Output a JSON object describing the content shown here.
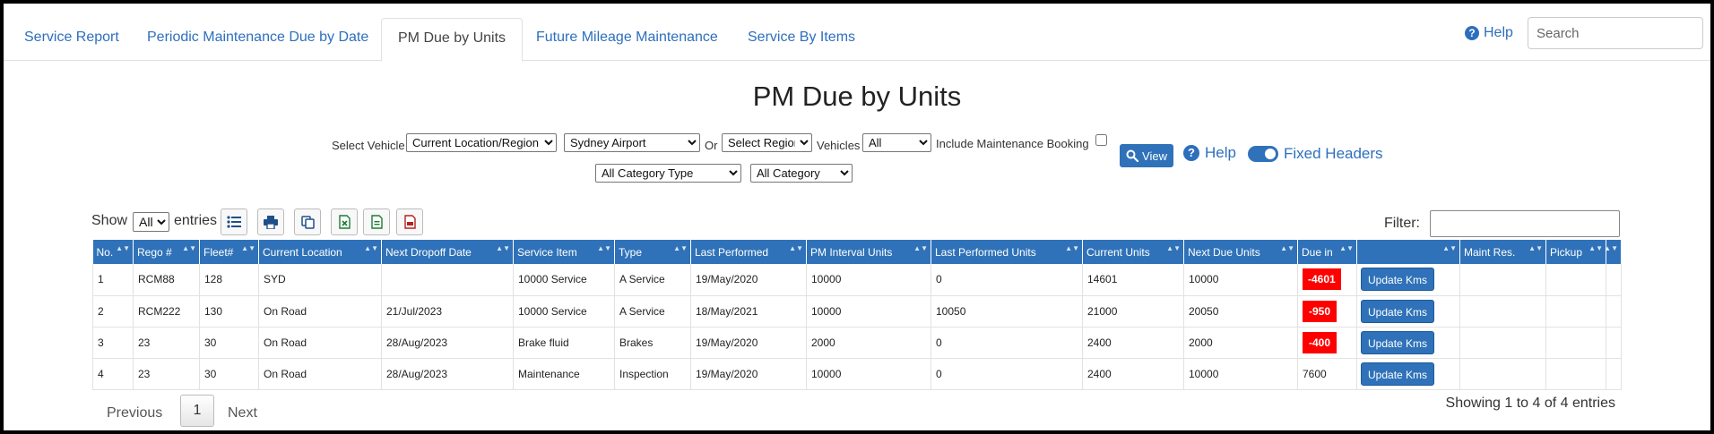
{
  "tabs": [
    {
      "label": "Service Report",
      "active": false
    },
    {
      "label": "Periodic Maintenance Due by Date",
      "active": false
    },
    {
      "label": "PM Due by Units",
      "active": true
    },
    {
      "label": "Future Mileage Maintenance",
      "active": false
    },
    {
      "label": "Service By Items",
      "active": false
    }
  ],
  "header": {
    "help_label": "Help",
    "search_placeholder": "Search"
  },
  "title": "PM Due by Units",
  "filters": {
    "select_vehicle_label": "Select Vehicle",
    "vehicle_mode": "Current Location/Region",
    "location": "Sydney Airport",
    "or_label": "Or",
    "region": "Select Region",
    "vehicles_label": "Vehicles",
    "vehicles": "All",
    "include_booking_label": "Include Maintenance Booking",
    "category_type": "All Category Type",
    "category": "All Category",
    "view_label": "View",
    "help_label": "Help",
    "fixed_headers_label": "Fixed Headers"
  },
  "table_controls": {
    "show_label": "Show",
    "entries_value": "All",
    "entries_label": "entries",
    "filter_label": "Filter:"
  },
  "table": {
    "columns": [
      "No.",
      "Rego #",
      "Fleet#",
      "Current Location",
      "Next Dropoff Date",
      "Service Item",
      "Type",
      "Last Performed",
      "PM Interval Units",
      "Last Performed Units",
      "Current Units",
      "Next Due Units",
      "Due in",
      "",
      "Maint Res.",
      "Pickup",
      ""
    ],
    "rows": [
      {
        "no": "1",
        "rego": "RCM88",
        "fleet": "128",
        "location": "SYD",
        "next_dropoff": "",
        "service_item": "10000 Service",
        "type": "A Service",
        "last_performed": "19/May/2020",
        "pm_interval": "10000",
        "last_units": "0",
        "current_units": "14601",
        "next_due": "10000",
        "due_in": "-4601",
        "overdue": true,
        "action": "Update Kms"
      },
      {
        "no": "2",
        "rego": "RCM222",
        "fleet": "130",
        "location": "On Road",
        "next_dropoff": "21/Jul/2023",
        "service_item": "10000 Service",
        "type": "A Service",
        "last_performed": "18/May/2021",
        "pm_interval": "10000",
        "last_units": "10050",
        "current_units": "21000",
        "next_due": "20050",
        "due_in": "-950",
        "overdue": true,
        "action": "Update Kms"
      },
      {
        "no": "3",
        "rego": "23",
        "fleet": "30",
        "location": "On Road",
        "next_dropoff": "28/Aug/2023",
        "service_item": "Brake fluid",
        "type": "Brakes",
        "last_performed": "19/May/2020",
        "pm_interval": "2000",
        "last_units": "0",
        "current_units": "2400",
        "next_due": "2000",
        "due_in": "-400",
        "overdue": true,
        "action": "Update Kms"
      },
      {
        "no": "4",
        "rego": "23",
        "fleet": "30",
        "location": "On Road",
        "next_dropoff": "28/Aug/2023",
        "service_item": "Maintenance",
        "type": "Inspection",
        "last_performed": "19/May/2020",
        "pm_interval": "10000",
        "last_units": "0",
        "current_units": "2400",
        "next_due": "10000",
        "due_in": "7600",
        "overdue": false,
        "action": "Update Kms"
      }
    ]
  },
  "pagination": {
    "previous": "Previous",
    "current": "1",
    "next": "Next",
    "info": "Showing 1 to 4 of 4 entries"
  },
  "colors": {
    "accent": "#2f72b9",
    "overdue": "#ff0000",
    "link": "#2d6fbd"
  }
}
